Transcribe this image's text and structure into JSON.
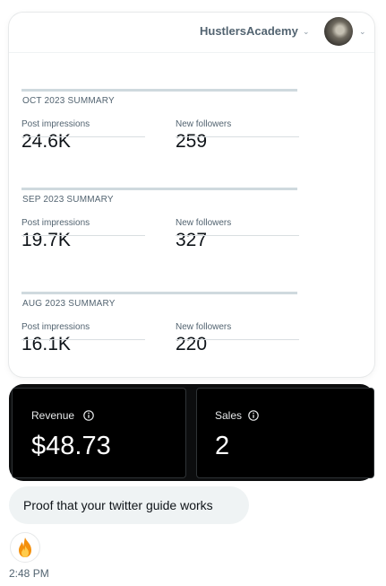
{
  "header": {
    "account_name": "HustlersAcademy"
  },
  "summaries": [
    {
      "title": "OCT 2023 SUMMARY",
      "impressions_label": "Post impressions",
      "impressions_value": "24.6K",
      "followers_label": "New followers",
      "followers_value": "259"
    },
    {
      "title": "SEP 2023 SUMMARY",
      "impressions_label": "Post impressions",
      "impressions_value": "19.7K",
      "followers_label": "New followers",
      "followers_value": "327"
    },
    {
      "title": "AUG 2023 SUMMARY",
      "impressions_label": "Post impressions",
      "impressions_value": "16.1K",
      "followers_label": "New followers",
      "followers_value": "220"
    }
  ],
  "stats": {
    "revenue_label": "Revenue",
    "revenue_value": "$48.73",
    "sales_label": "Sales",
    "sales_value": "2"
  },
  "message": {
    "text": "Proof that your twitter guide works",
    "reaction_icon": "fire-icon",
    "time": "2:48 PM"
  },
  "icons": {
    "account_dropdown": "chevron-down-icon",
    "avatar_dropdown": "chevron-down-icon",
    "info": "info-icon"
  },
  "colors": {
    "muted_text": "#536471",
    "stats_background": "#000000",
    "bubble_background": "#eff3f4"
  }
}
